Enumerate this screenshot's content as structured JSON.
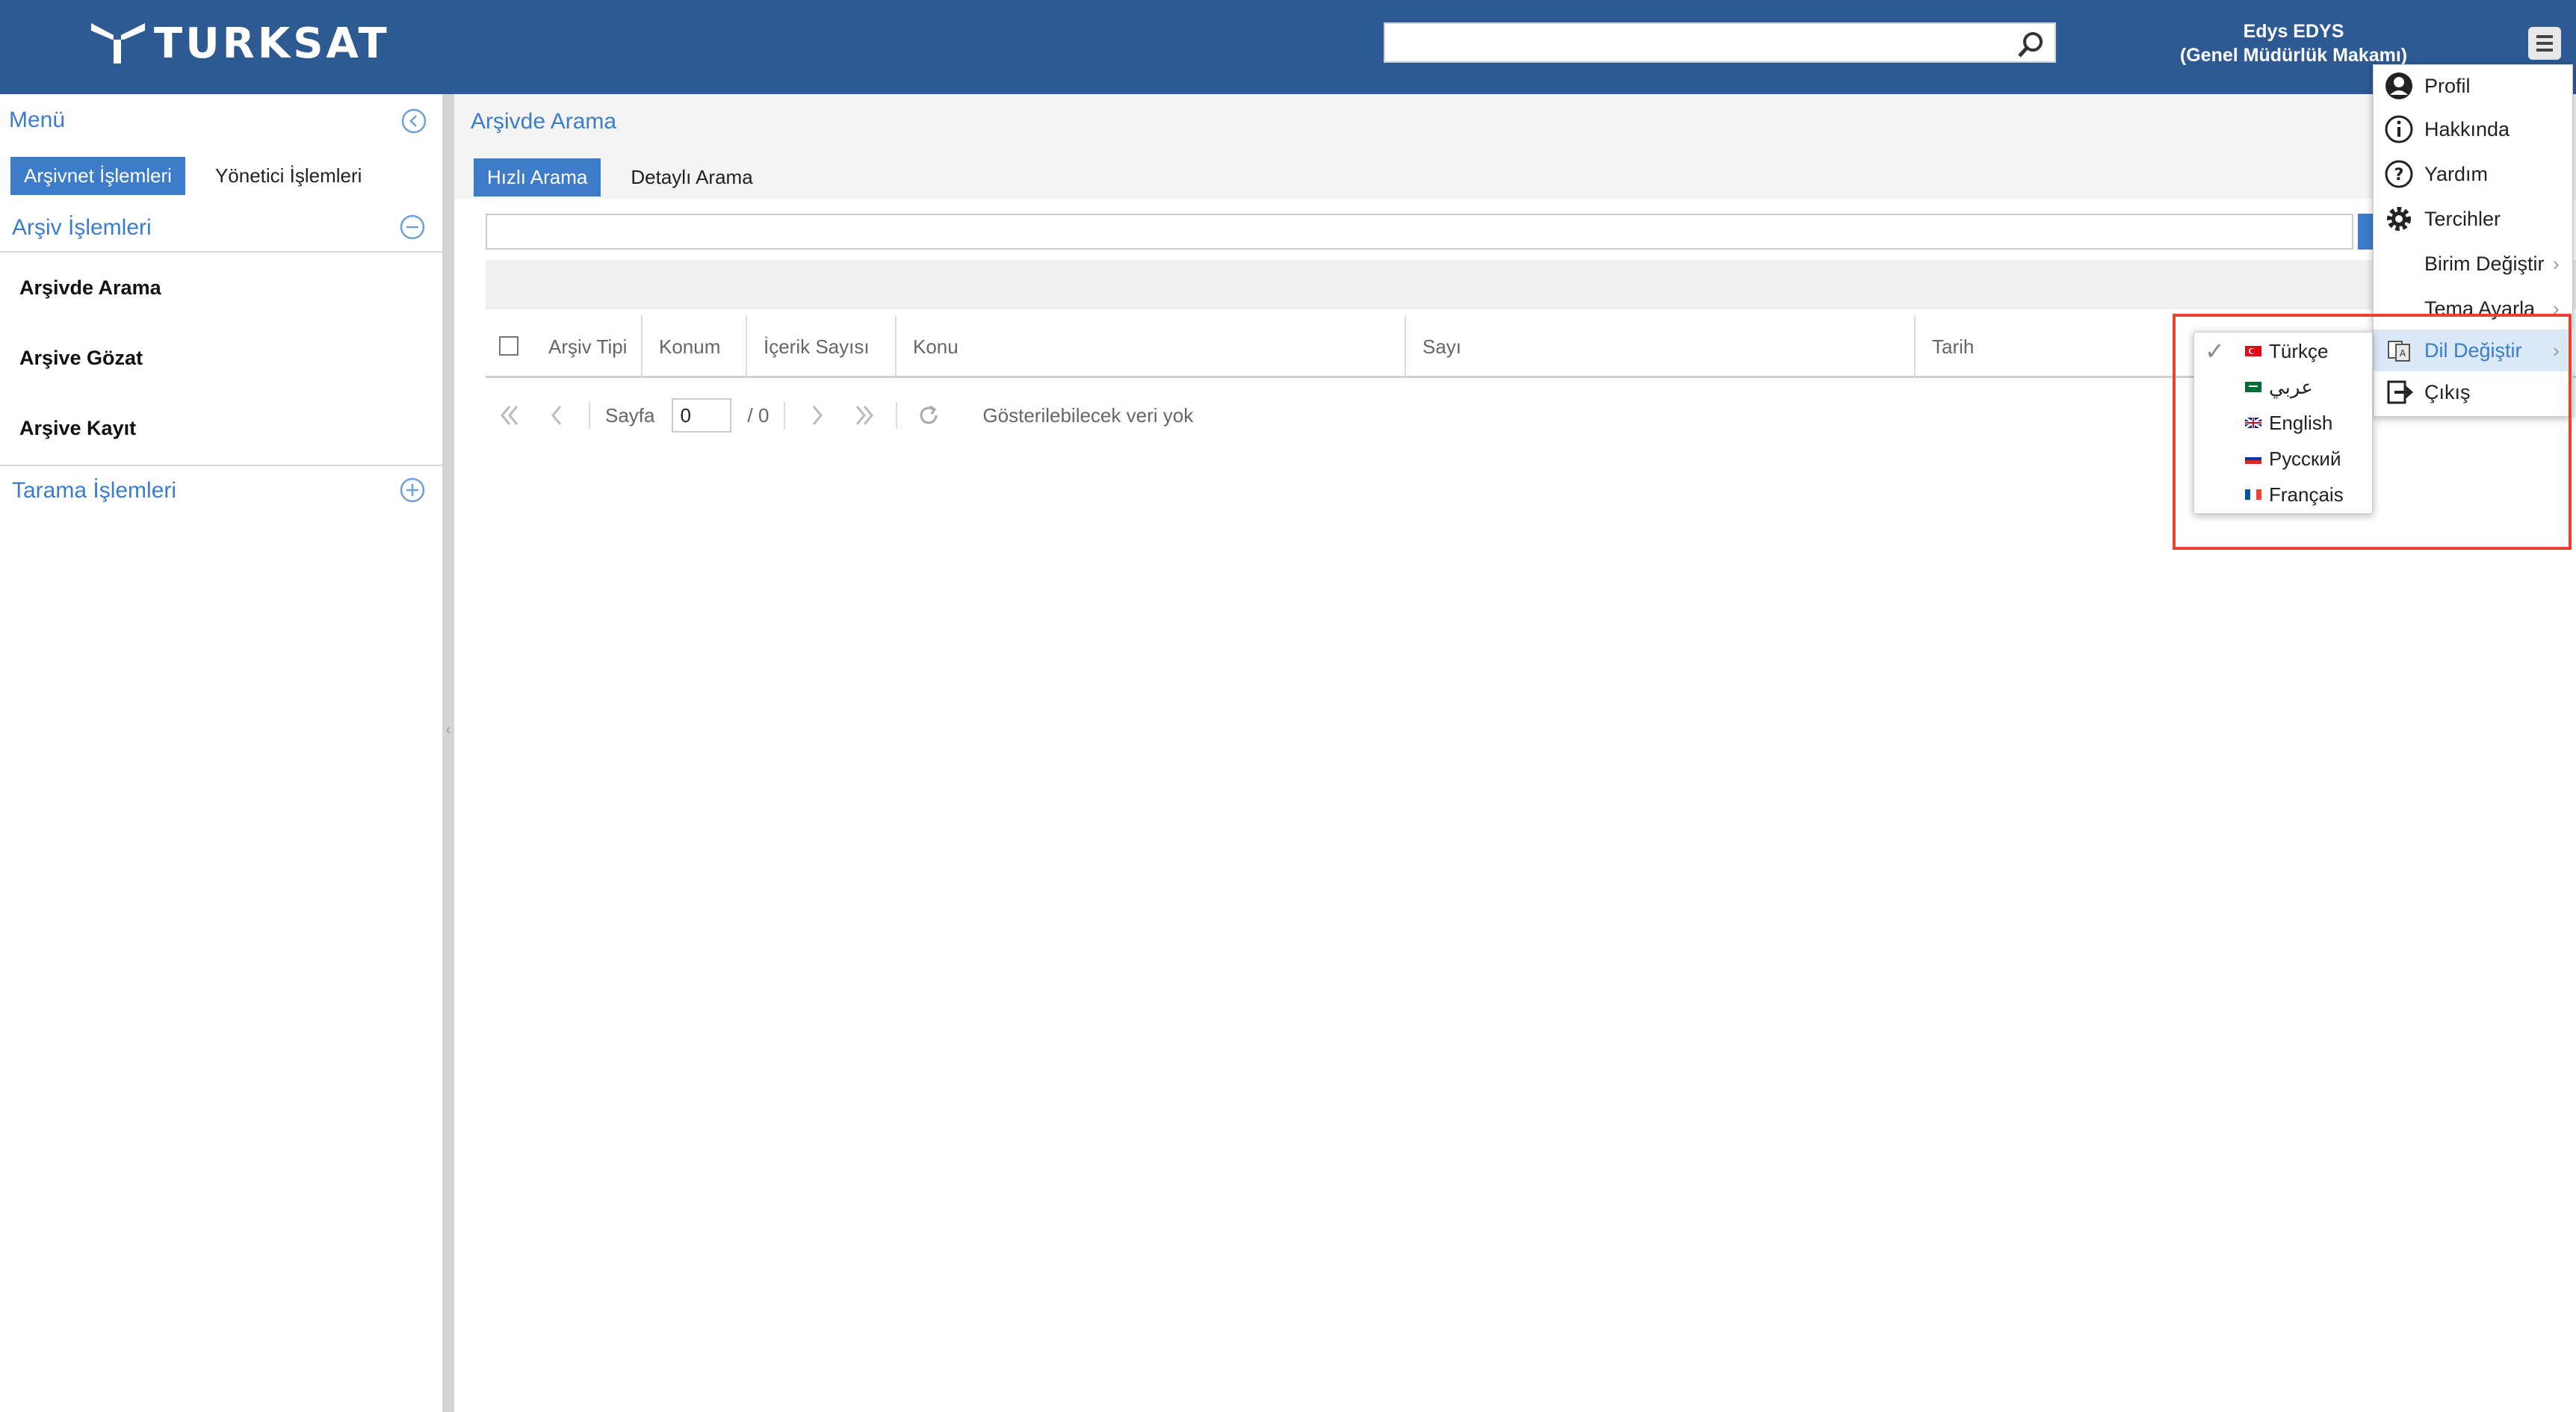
{
  "header": {
    "brand": "TURKSAT",
    "search_placeholder": "",
    "user_name": "Edys EDYS",
    "user_unit": "(Genel Müdürlük Makamı)"
  },
  "sidebar": {
    "title": "Menü",
    "tabs": [
      {
        "label": "Arşivnet İşlemleri",
        "active": true
      },
      {
        "label": "Yönetici İşlemleri",
        "active": false
      }
    ],
    "section_archive": "Arşiv İşlemleri",
    "items": [
      {
        "label": "Arşivde Arama"
      },
      {
        "label": "Arşive Gözat"
      },
      {
        "label": "Arşive Kayıt"
      }
    ],
    "section_scan": "Tarama İşlemleri"
  },
  "main": {
    "title": "Arşivde Arama",
    "tabs": [
      {
        "label": "Hızlı Arama",
        "active": true
      },
      {
        "label": "Detaylı Arama",
        "active": false
      }
    ],
    "columns": [
      "Arşiv Tipi",
      "Konum",
      "İçerik Sayısı",
      "Konu",
      "Sayı",
      "Tarih"
    ],
    "pager": {
      "page_label": "Sayfa",
      "page_value": "0",
      "page_total": "/ 0",
      "empty_text": "Gösterilebilecek veri yok"
    }
  },
  "user_menu": {
    "items": [
      {
        "label": "Profil",
        "icon": "profile-icon"
      },
      {
        "label": "Hakkında",
        "icon": "info-icon"
      },
      {
        "label": "Yardım",
        "icon": "help-icon"
      },
      {
        "label": "Tercihler",
        "icon": "gear-icon"
      },
      {
        "label": "Birim Değiştir",
        "icon": "",
        "submenu": true
      },
      {
        "label": "Tema Ayarla",
        "icon": "",
        "submenu": true
      },
      {
        "label": "Dil Değiştir",
        "icon": "language-icon",
        "submenu": true,
        "active": true
      },
      {
        "label": "Çıkış",
        "icon": "logout-icon"
      }
    ]
  },
  "language_menu": {
    "items": [
      {
        "label": "Türkçe",
        "flag": "tr-flag-icon",
        "selected": true
      },
      {
        "label": "عربي",
        "flag": "sa-flag-icon",
        "selected": false
      },
      {
        "label": "English",
        "flag": "gb-flag-icon",
        "selected": false
      },
      {
        "label": "Русский",
        "flag": "ru-flag-icon",
        "selected": false
      },
      {
        "label": "Français",
        "flag": "fr-flag-icon",
        "selected": false
      }
    ]
  },
  "colors": {
    "header_bg": "#2e5a94",
    "accent": "#3d7cc9",
    "highlight": "#e8432c"
  }
}
